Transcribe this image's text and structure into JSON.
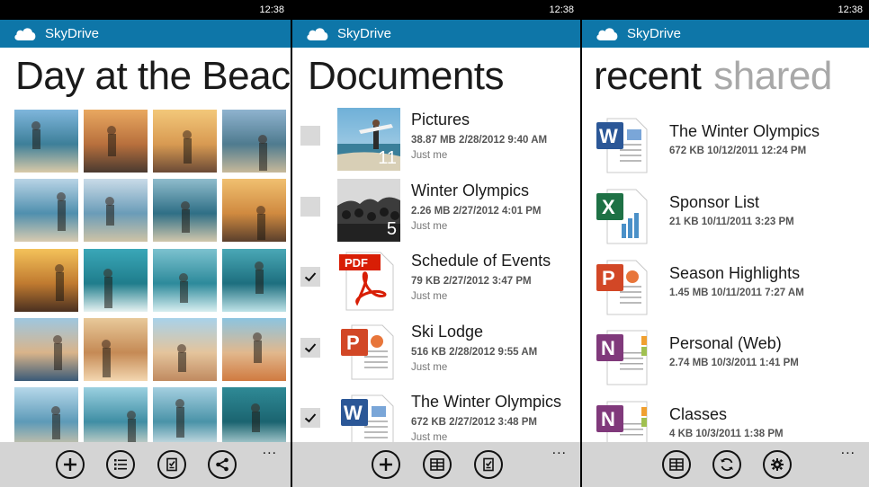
{
  "status": {
    "time": "12:38"
  },
  "app": {
    "name": "SkyDrive"
  },
  "panel1": {
    "title": "Day at the Beach",
    "photo_count": 20,
    "more": "..."
  },
  "panel2": {
    "title": "Documents",
    "items": [
      {
        "name": "Pictures",
        "meta": "38.87 MB  2/28/2012 9:40 AM",
        "owner": "Just me",
        "count": "11",
        "checked": false,
        "icon": "folder-photos"
      },
      {
        "name": "Winter Olympics",
        "meta": "2.26 MB  2/27/2012 4:01 PM",
        "owner": "Just me",
        "count": "5",
        "checked": false,
        "icon": "folder-photos"
      },
      {
        "name": "Schedule of Events",
        "meta": "79 KB  2/27/2012 3:47 PM",
        "owner": "Just me",
        "checked": true,
        "icon": "pdf-icon",
        "pdf_label": "PDF"
      },
      {
        "name": "Ski Lodge",
        "meta": "516 KB  2/28/2012 9:55 AM",
        "owner": "Just me",
        "checked": true,
        "icon": "powerpoint-icon"
      },
      {
        "name": "The Winter Olympics",
        "meta": "672 KB  2/27/2012 3:48 PM",
        "owner": "Just me",
        "checked": true,
        "icon": "word-icon"
      }
    ],
    "more": "..."
  },
  "panel3": {
    "pivot_active": "recent",
    "pivot_inactive": "shared",
    "items": [
      {
        "name": "The Winter Olympics",
        "meta": "672 KB  10/12/2011 12:24 PM",
        "icon": "word-icon"
      },
      {
        "name": "Sponsor List",
        "meta": "21 KB  10/11/2011 3:23 PM",
        "icon": "excel-icon"
      },
      {
        "name": "Season Highlights",
        "meta": "1.45 MB  10/11/2011 7:27 AM",
        "icon": "powerpoint-icon"
      },
      {
        "name": "Personal (Web)",
        "meta": "2.74 MB  10/3/2011 1:41 PM",
        "icon": "onenote-icon"
      },
      {
        "name": "Classes",
        "meta": "4 KB  10/3/2011 1:38 PM",
        "icon": "onenote-icon"
      }
    ],
    "more": "..."
  },
  "colors": {
    "brand": "#0e76a8",
    "appbar_bg": "#d4d4d4",
    "word": "#2b5797",
    "excel": "#1e7145",
    "powerpoint": "#d24726",
    "onenote": "#80397b",
    "pdf": "#d81e05"
  }
}
